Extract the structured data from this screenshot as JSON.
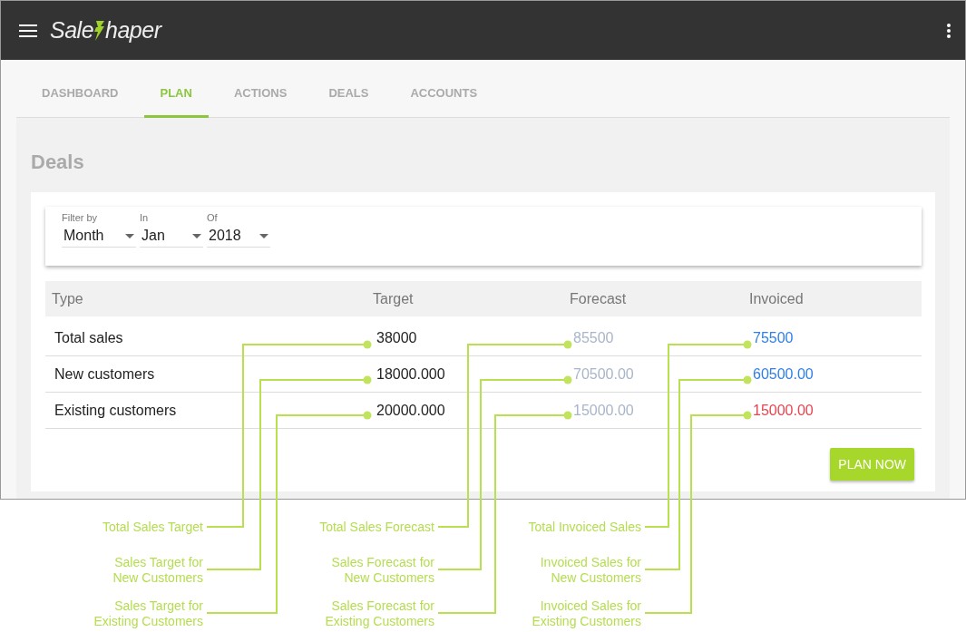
{
  "app_bar": {
    "logo": {
      "before": "Sale",
      "after": "haper"
    }
  },
  "tabs": [
    {
      "label": "DASHBOARD",
      "selected": false
    },
    {
      "label": "PLAN",
      "selected": true
    },
    {
      "label": "ACTIONS",
      "selected": false
    },
    {
      "label": "DEALS",
      "selected": false
    },
    {
      "label": "ACCOUNTS",
      "selected": false
    }
  ],
  "page_title": "Deals",
  "filters": [
    {
      "label": "Filter by",
      "value": "Month"
    },
    {
      "label": "In",
      "value": "Jan"
    },
    {
      "label": "Of",
      "value": "2018"
    }
  ],
  "table": {
    "columns": [
      "Type",
      "Target",
      "Forecast",
      "Invoiced"
    ],
    "rows": [
      {
        "cells": [
          {
            "text": "Total sales",
            "color": "#222222"
          },
          {
            "text": "38000",
            "color": "#222222"
          },
          {
            "text": "85500",
            "color": "#a9b5c9"
          },
          {
            "text": "75500",
            "color": "#2f7fe6"
          }
        ]
      },
      {
        "cells": [
          {
            "text": "New customers",
            "color": "#222222"
          },
          {
            "text": "18000.000",
            "color": "#222222"
          },
          {
            "text": "70500.00",
            "color": "#a9b5c9"
          },
          {
            "text": "60500.00",
            "color": "#2f7fe6"
          }
        ]
      },
      {
        "cells": [
          {
            "text": "Existing customers",
            "color": "#222222"
          },
          {
            "text": "20000.000",
            "color": "#222222"
          },
          {
            "text": "15000.00",
            "color": "#a9b5c9"
          },
          {
            "text": "15000.00",
            "color": "#e84550"
          }
        ]
      }
    ]
  },
  "action_button": "PLAN NOW",
  "annotations": [
    "Total Sales Target",
    "Total Sales Forecast",
    "Total Invoiced Sales",
    "Sales Target for\nNew Customers",
    "Sales Forecast for\nNew Customers",
    "Invoiced Sales for\nNew Customers",
    "Sales Target for\nExisting Customers",
    "Sales Forecast for\nExisting Customers",
    "Invoiced Sales for\nExisting Customers"
  ]
}
